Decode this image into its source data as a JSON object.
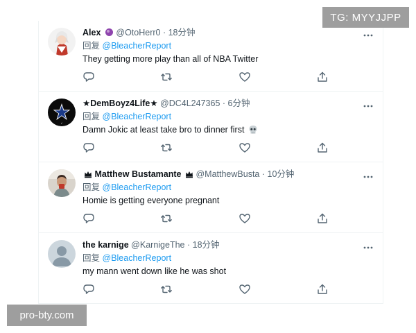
{
  "watermark": {
    "top_right": "TG: MYYJJPP",
    "bottom_left": "pro-bty.com"
  },
  "reply_prefix": "回复",
  "tweets": [
    {
      "name": "Alex",
      "handle": "@OtoHerr0",
      "dot": "·",
      "time": "18分钟",
      "reply_to": "@BleacherReport",
      "text": "They getting more play than all of NBA Twitter",
      "badge_icon": "purple-orb-icon",
      "avatar_icon": "anime-avatar"
    },
    {
      "name": "★DemBoyz4Life★",
      "handle": "@DC4L247365",
      "dot": "·",
      "time": "6分钟",
      "reply_to": "@BleacherReport",
      "text": "Damn Jokic at least take bro to dinner first",
      "text_emoji_icon": "skull-icon",
      "avatar_icon": "cowboys-star-avatar"
    },
    {
      "name": "Matthew Bustamante",
      "handle": "@MatthewBusta",
      "dot": "·",
      "time": "10分钟",
      "reply_to": "@BleacherReport",
      "text": "Homie is getting everyone pregnant",
      "name_prefix_icon": "crown-icon",
      "name_suffix_icon": "crown-icon",
      "avatar_icon": "person-photo-avatar"
    },
    {
      "name": "the karnige",
      "handle": "@KarnigeThe",
      "dot": "·",
      "time": "18分钟",
      "reply_to": "@BleacherReport",
      "text": "my mann went down like he was shot",
      "avatar_icon": "default-avatar"
    }
  ],
  "actions": [
    "reply-icon",
    "retweet-icon",
    "like-icon",
    "share-icon"
  ],
  "colors": {
    "link": "#1d9bf0",
    "muted": "#536471",
    "text": "#0f1419",
    "divider": "#eff3f4",
    "watermark_bg": "#9e9e9e"
  }
}
